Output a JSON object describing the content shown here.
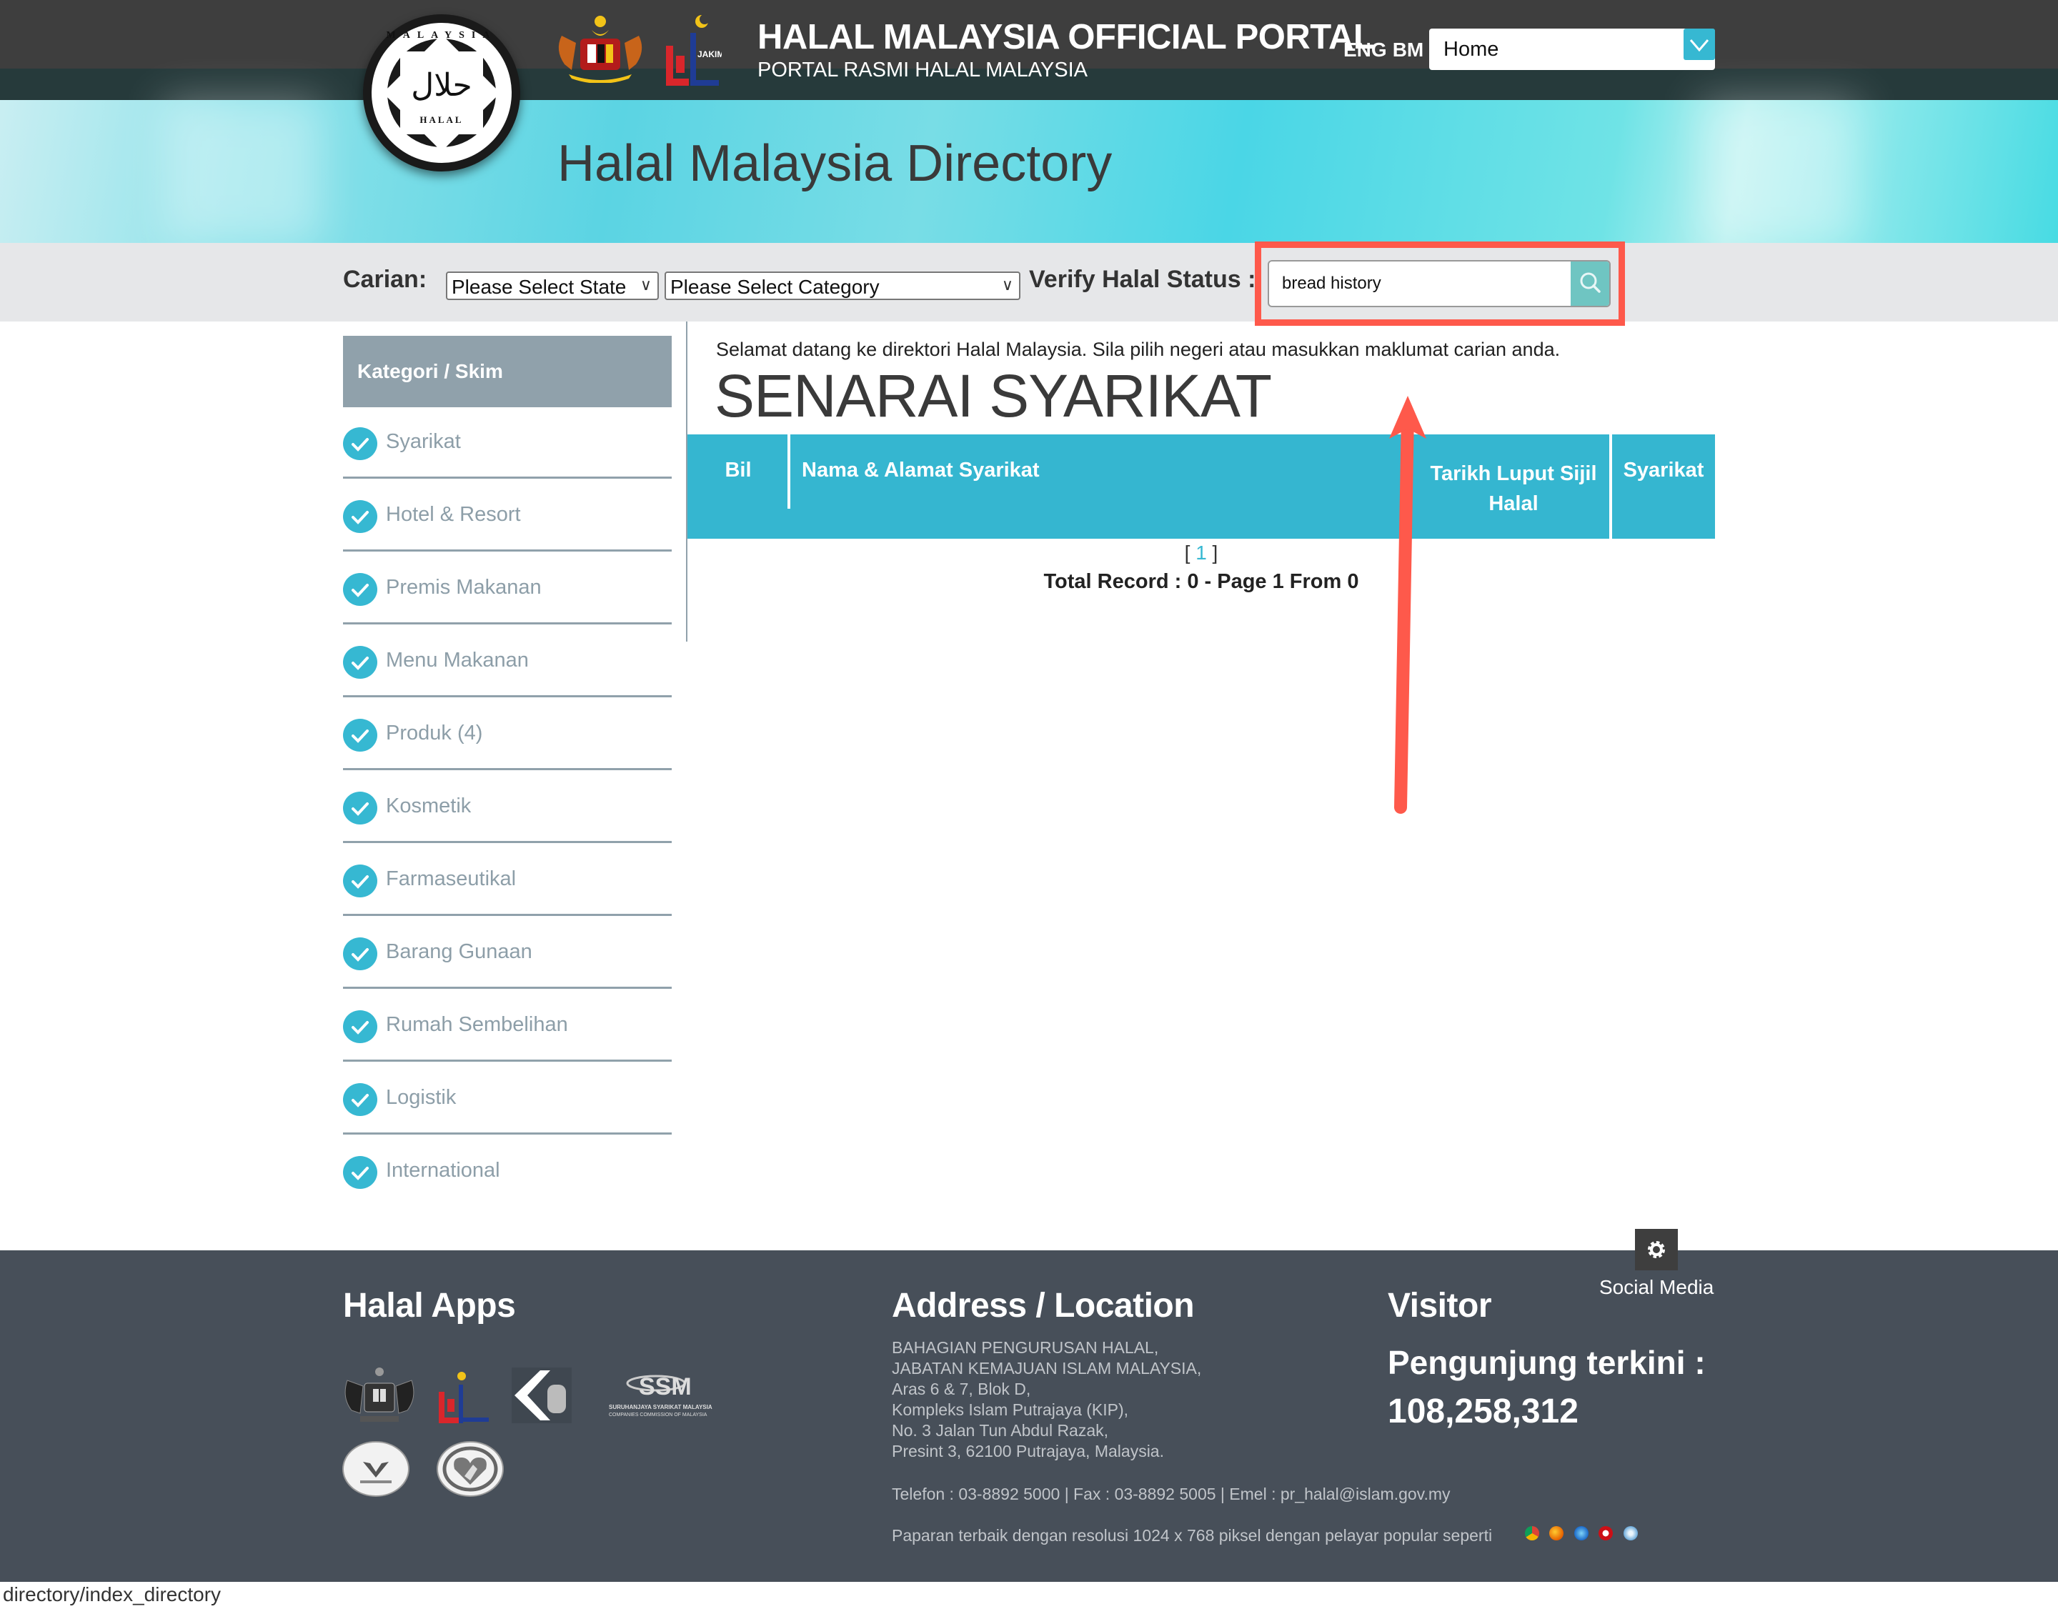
{
  "header": {
    "portal_title": "HALAL MALAYSIA OFFICIAL PORTAL",
    "portal_subtitle": "PORTAL RASMI HALAL MALAYSIA",
    "lang_eng": "ENG",
    "lang_bm": "BM",
    "nav_select_value": "Home",
    "logo_arabic": "حلال",
    "logo_word": "HALAL",
    "logo_ring_text": "MALAYSIA",
    "jakim_label": "JAKIM",
    "directory_title": "Halal Malaysia Directory"
  },
  "search": {
    "carian_label": "Carian:",
    "state_select": "Please Select State",
    "category_select": "Please Select Category",
    "verify_label": "Verify Halal Status :",
    "query_value": "bread history",
    "chevron": "∨"
  },
  "sidebar": {
    "heading": "Kategori / Skim",
    "items": [
      {
        "label": "Syarikat"
      },
      {
        "label": "Hotel & Resort"
      },
      {
        "label": "Premis Makanan"
      },
      {
        "label": "Menu Makanan"
      },
      {
        "label": "Produk (4)"
      },
      {
        "label": "Kosmetik"
      },
      {
        "label": "Farmaseutikal"
      },
      {
        "label": "Barang Gunaan"
      },
      {
        "label": "Rumah Sembelihan"
      },
      {
        "label": "Logistik"
      },
      {
        "label": "International"
      }
    ]
  },
  "main": {
    "welcome": "Selamat datang ke direktori Halal Malaysia. Sila pilih negeri atau masukkan maklumat carian anda.",
    "heading": "SENARAI SYARIKAT",
    "columns": [
      {
        "label": "Bil"
      },
      {
        "label": "Nama & Alamat Syarikat"
      },
      {
        "label_line1": "Tarikh Luput Sijil",
        "label_line2": "Halal"
      },
      {
        "label": "Syarikat"
      }
    ],
    "rows": [],
    "pager_open": "[ ",
    "pager_page": "1",
    "pager_close": " ]",
    "total": "Total Record : 0 - Page 1 From 0"
  },
  "footer": {
    "social_media": "Social Media",
    "apps_heading": "Halal Apps",
    "apps": [
      "Jata Negara",
      "JAKIM",
      "KPDNHEP",
      "SSM - Suruhanjaya Syarikat Malaysia",
      "Veterinary Inspected Malaysia",
      "Kami Sedia Membantu"
    ],
    "ssm_line1": "SURUHANJAYA SYARIKAT MALAYSIA",
    "ssm_line2": "COMPANIES COMMISSION OF MALAYSIA",
    "address_heading": "Address / Location",
    "address": "BAHAGIAN PENGURUSAN HALAL,\nJABATAN KEMAJUAN ISLAM MALAYSIA,\nAras 6 & 7, Blok D,\nKompleks Islam Putrajaya (KIP),\nNo. 3 Jalan Tun Abdul Razak,\nPresint 3, 62100 Putrajaya, Malaysia.",
    "contact": "Telefon : 03-8892 5000 | Fax : 03-8892 5005 | Emel : pr_halal@islam.gov.my",
    "best_view": "Paparan terbaik dengan resolusi 1024 x 768 piksel dengan pelayar popular seperti",
    "browsers": [
      "chrome",
      "firefox",
      "internet-explorer",
      "opera",
      "safari"
    ],
    "visitor_heading": "Visitor",
    "visitor_label": "Pengunjung terkini :",
    "visitor_count": "108,258,312"
  },
  "status_bar": {
    "url": "directory/index_directory"
  },
  "colors": {
    "accent": "#36b8d2",
    "topbar": "#3e3e3e",
    "footer": "#474f59",
    "sidebar_head": "#90a1ab",
    "annotation": "#fe594b"
  }
}
